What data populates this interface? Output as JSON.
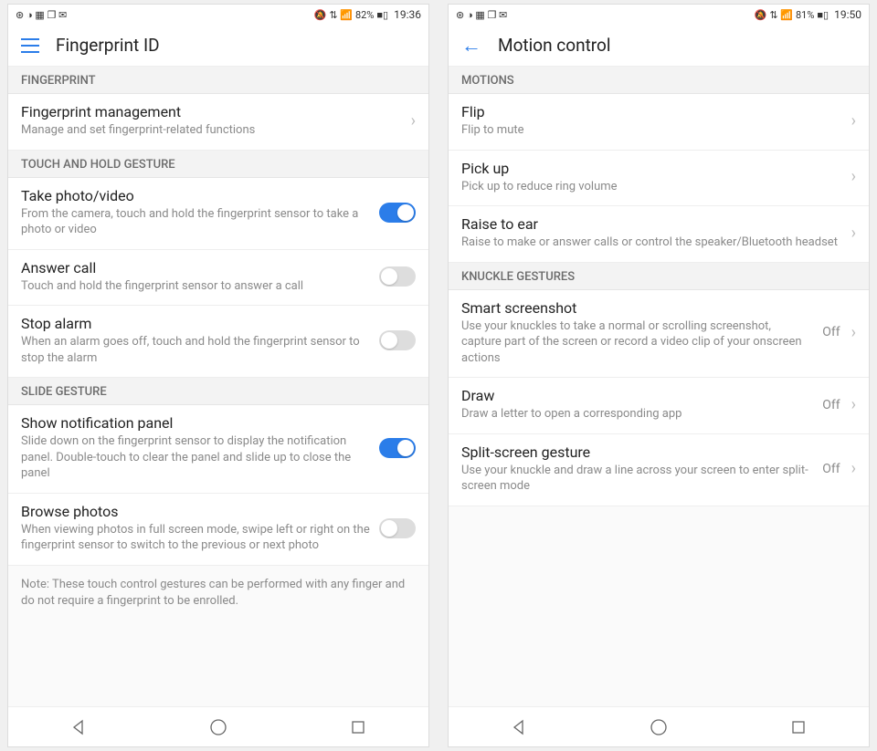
{
  "left": {
    "status": {
      "icons_left": "⊛ ◑ ▦ ❐ ✉",
      "icons_right": "🔕 ⇅ 📶",
      "battery_pct": "82%",
      "battery_icon": "■▯",
      "time": "19:36"
    },
    "header": {
      "title": "Fingerprint ID"
    },
    "sections": [
      {
        "header": "FINGERPRINT",
        "rows": [
          {
            "title": "Fingerprint management",
            "desc": "Manage and set fingerprint-related functions",
            "type": "arrow"
          }
        ]
      },
      {
        "header": "TOUCH AND HOLD GESTURE",
        "rows": [
          {
            "title": "Take photo/video",
            "desc": "From the camera, touch and hold the fingerprint sensor to take a photo or video",
            "type": "toggle",
            "on": true
          },
          {
            "title": "Answer call",
            "desc": "Touch and hold the fingerprint sensor to answer a call",
            "type": "toggle",
            "on": false
          },
          {
            "title": "Stop alarm",
            "desc": "When an alarm goes off, touch and hold the fingerprint sensor to stop the alarm",
            "type": "toggle",
            "on": false
          }
        ]
      },
      {
        "header": "SLIDE GESTURE",
        "rows": [
          {
            "title": "Show notification panel",
            "desc": "Slide down on the fingerprint sensor to display the notification panel. Double-touch to clear the panel and slide up to close the panel",
            "type": "toggle",
            "on": true
          },
          {
            "title": "Browse photos",
            "desc": "When viewing photos in full screen mode, swipe left or right on the fingerprint sensor to switch to the previous or next photo",
            "type": "toggle",
            "on": false
          }
        ],
        "note": "Note: These touch control gestures can be performed with any finger and do not require a fingerprint to be enrolled."
      }
    ]
  },
  "right": {
    "status": {
      "icons_left": "⊛ ◑ ▦ ❐ ✉",
      "icons_right": "🔕 ⇅ 📶",
      "battery_pct": "81%",
      "battery_icon": "■▯",
      "time": "19:50"
    },
    "header": {
      "title": "Motion control"
    },
    "sections": [
      {
        "header": "MOTIONS",
        "rows": [
          {
            "title": "Flip",
            "desc": "Flip to mute",
            "type": "arrow"
          },
          {
            "title": "Pick up",
            "desc": "Pick up to reduce ring volume",
            "type": "arrow"
          },
          {
            "title": "Raise to ear",
            "desc": "Raise to make or answer calls or control the speaker/Bluetooth headset",
            "type": "arrow"
          }
        ]
      },
      {
        "header": "KNUCKLE GESTURES",
        "rows": [
          {
            "title": "Smart screenshot",
            "desc": "Use your knuckles to take a normal or scrolling screenshot, capture part of the screen or record a video clip of your onscreen actions",
            "type": "value-arrow",
            "value": "Off"
          },
          {
            "title": "Draw",
            "desc": "Draw a letter to open a corresponding app",
            "type": "value-arrow",
            "value": "Off"
          },
          {
            "title": "Split-screen gesture",
            "desc": "Use your knuckle and draw a line across your screen to enter split-screen mode",
            "type": "value-arrow",
            "value": "Off"
          }
        ]
      }
    ]
  }
}
